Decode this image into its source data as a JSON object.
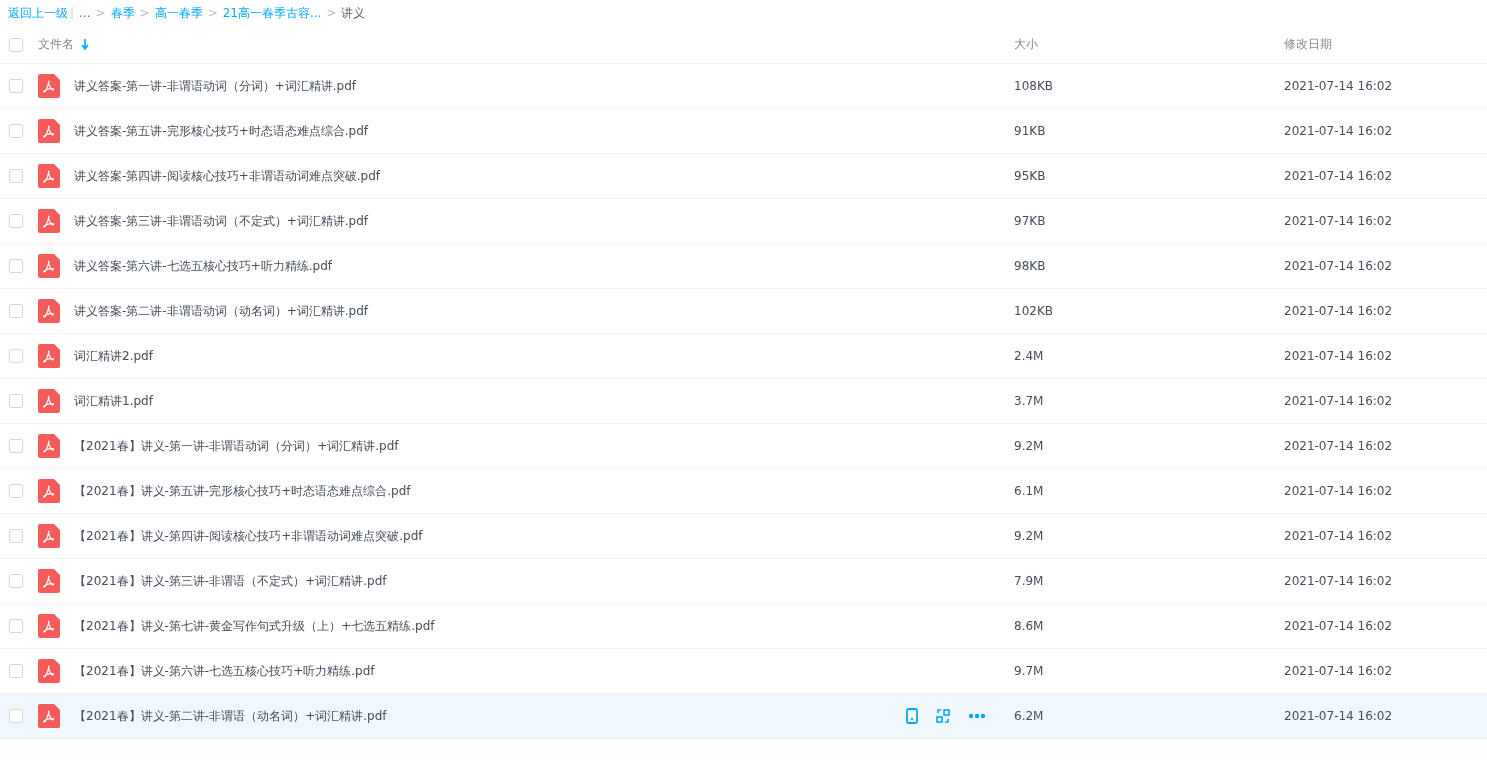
{
  "breadcrumb": {
    "back": "返回上一级",
    "divider": "|",
    "separator": ">",
    "items": [
      {
        "label": "...",
        "link": false
      },
      {
        "label": "春季",
        "link": true
      },
      {
        "label": "高一春季",
        "link": true
      },
      {
        "label": "21高一春季古容...",
        "link": true
      },
      {
        "label": "讲义",
        "link": false
      }
    ]
  },
  "table": {
    "columns": [
      {
        "label": "文件名",
        "sorted": true
      },
      {
        "label": "大小",
        "sorted": false
      },
      {
        "label": "修改日期",
        "sorted": false
      }
    ],
    "all_checked": false,
    "rows": [
      {
        "name": "讲义答案-第一讲-非谓语动词（分词）+词汇精讲.pdf",
        "size": "108KB",
        "date": "2021-07-14 16:02",
        "checked": false,
        "hovered": false
      },
      {
        "name": "讲义答案-第五讲-完形核心技巧+时态语态难点综合.pdf",
        "size": "91KB",
        "date": "2021-07-14 16:02",
        "checked": false,
        "hovered": false
      },
      {
        "name": "讲义答案-第四讲-阅读核心技巧+非谓语动词难点突破.pdf",
        "size": "95KB",
        "date": "2021-07-14 16:02",
        "checked": false,
        "hovered": false
      },
      {
        "name": "讲义答案-第三讲-非谓语动词（不定式）+词汇精讲.pdf",
        "size": "97KB",
        "date": "2021-07-14 16:02",
        "checked": false,
        "hovered": false
      },
      {
        "name": "讲义答案-第六讲-七选五核心技巧+听力精练.pdf",
        "size": "98KB",
        "date": "2021-07-14 16:02",
        "checked": false,
        "hovered": false
      },
      {
        "name": "讲义答案-第二讲-非谓语动词（动名词）+词汇精讲.pdf",
        "size": "102KB",
        "date": "2021-07-14 16:02",
        "checked": false,
        "hovered": false
      },
      {
        "name": "词汇精讲2.pdf",
        "size": "2.4M",
        "date": "2021-07-14 16:02",
        "checked": false,
        "hovered": false
      },
      {
        "name": "词汇精讲1.pdf",
        "size": "3.7M",
        "date": "2021-07-14 16:02",
        "checked": false,
        "hovered": false
      },
      {
        "name": "【2021春】讲义-第一讲-非谓语动词（分词）+词汇精讲.pdf",
        "size": "9.2M",
        "date": "2021-07-14 16:02",
        "checked": false,
        "hovered": false
      },
      {
        "name": "【2021春】讲义-第五讲-完形核心技巧+时态语态难点综合.pdf",
        "size": "6.1M",
        "date": "2021-07-14 16:02",
        "checked": false,
        "hovered": false
      },
      {
        "name": "【2021春】讲义-第四讲-阅读核心技巧+非谓语动词难点突破.pdf",
        "size": "9.2M",
        "date": "2021-07-14 16:02",
        "checked": false,
        "hovered": false
      },
      {
        "name": "【2021春】讲义-第三讲-非谓语（不定式）+词汇精讲.pdf",
        "size": "7.9M",
        "date": "2021-07-14 16:02",
        "checked": false,
        "hovered": false
      },
      {
        "name": "【2021春】讲义-第七讲-黄金写作句式升级（上）+七选五精练.pdf",
        "size": "8.6M",
        "date": "2021-07-14 16:02",
        "checked": false,
        "hovered": false
      },
      {
        "name": "【2021春】讲义-第六讲-七选五核心技巧+听力精练.pdf",
        "size": "9.7M",
        "date": "2021-07-14 16:02",
        "checked": false,
        "hovered": false
      },
      {
        "name": "【2021春】讲义-第二讲-非谓语（动名词）+词汇精讲.pdf",
        "size": "6.2M",
        "date": "2021-07-14 16:02",
        "checked": false,
        "hovered": true
      }
    ]
  }
}
